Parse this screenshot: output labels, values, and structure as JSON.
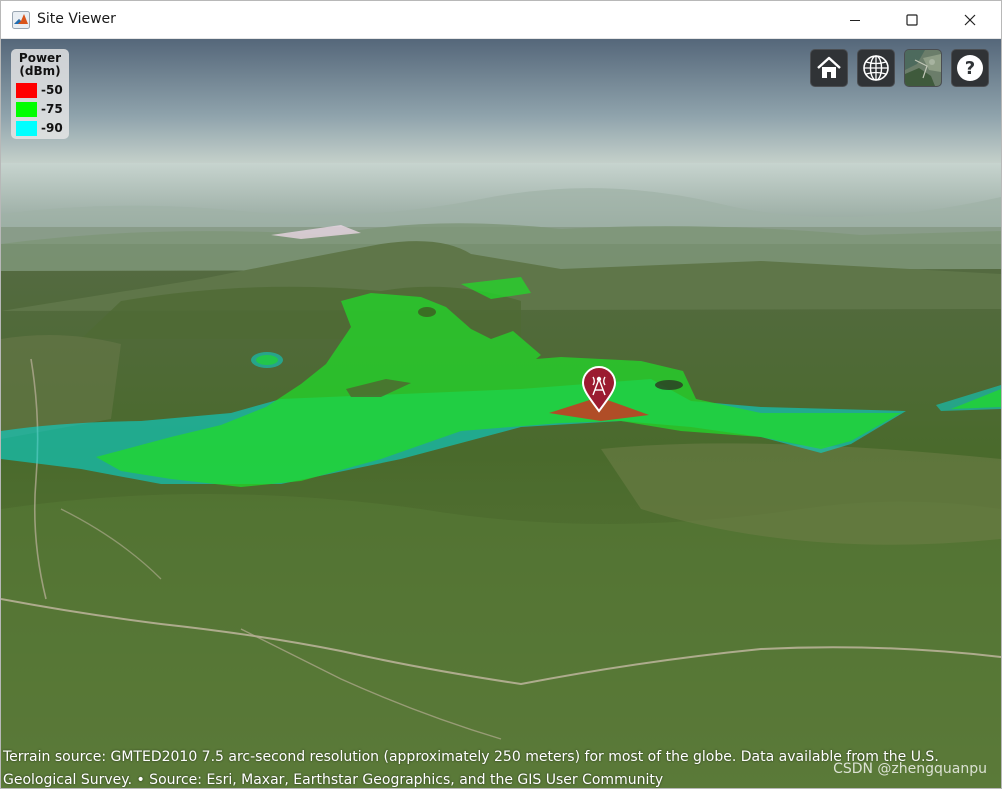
{
  "window": {
    "title": "Site Viewer",
    "controls": [
      "minimize",
      "maximize",
      "close"
    ]
  },
  "legend": {
    "title_line1": "Power",
    "title_line2": "(dBm)",
    "entries": [
      {
        "label": "-50",
        "color": "#ff0000"
      },
      {
        "label": "-75",
        "color": "#00ff00"
      },
      {
        "label": "-90",
        "color": "#00ffff"
      }
    ]
  },
  "toolbar": {
    "buttons": [
      {
        "name": "home",
        "icon": "home-icon"
      },
      {
        "name": "scene-mode",
        "icon": "globe-icon"
      },
      {
        "name": "basemap-picker",
        "icon": "satellite-imagery-icon"
      },
      {
        "name": "help",
        "icon": "help-icon",
        "label": "?"
      }
    ]
  },
  "map": {
    "site_marker_icon": "antenna-tower-icon",
    "marker_color": "#9b1b30"
  },
  "attribution": {
    "line1": "Terrain source: GMTED2010 7.5 arc-second resolution (approximately 250 meters) for most of the globe. Data available from the U.S.",
    "line2": "Geological Survey. • Source: Esri, Maxar, Earthstar Geographics, and the GIS User Community"
  },
  "watermark": "CSDN @zhengquanpu"
}
